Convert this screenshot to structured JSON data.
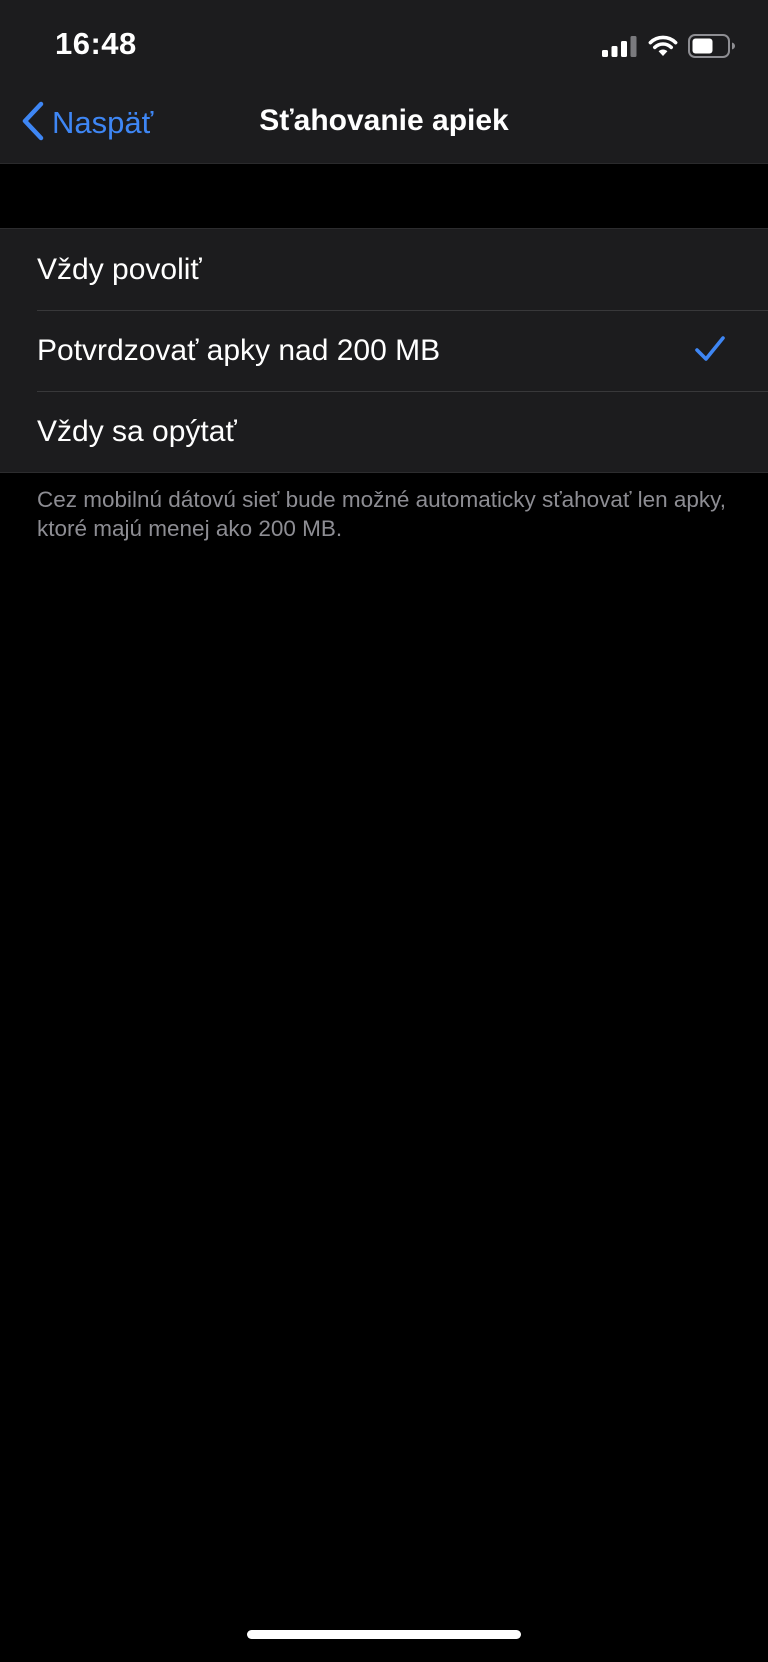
{
  "status_bar": {
    "time": "16:48",
    "icons": [
      "cellular-signal-icon",
      "wifi-icon",
      "battery-icon"
    ]
  },
  "nav": {
    "back_label": "Naspäť",
    "title": "Sťahovanie apiek"
  },
  "options": [
    {
      "label": "Vždy povoliť",
      "selected": false
    },
    {
      "label": "Potvrdzovať apky nad 200 MB",
      "selected": true
    },
    {
      "label": "Vždy sa opýtať",
      "selected": false
    }
  ],
  "footer_note": "Cez mobilnú dátovú sieť bude možné automaticky sťahovať len apky, ktoré majú menej ako 200 MB.",
  "colors": {
    "accent": "#3e86f4",
    "background": "#000000",
    "group_background": "#1c1c1e",
    "secondary_text": "#8d8d93"
  }
}
